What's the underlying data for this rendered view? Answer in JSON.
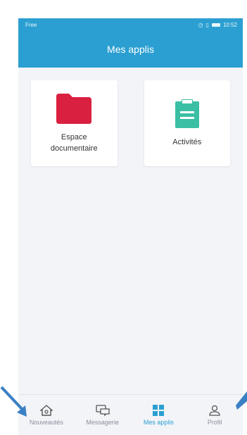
{
  "status_bar": {
    "carrier": "Free",
    "time": "10:52"
  },
  "header": {
    "title": "Mes applis"
  },
  "apps": [
    {
      "label": "Espace documentaire",
      "icon": "folder-icon",
      "color": "#d92040"
    },
    {
      "label": "Activités",
      "icon": "clipboard-icon",
      "color": "#3bbfa4"
    }
  ],
  "bottom_nav": {
    "items": [
      {
        "label": "Nouveautés",
        "icon": "home-icon",
        "active": false
      },
      {
        "label": "Messagerie",
        "icon": "chat-icon",
        "active": false
      },
      {
        "label": "Mes applis",
        "icon": "grid-icon",
        "active": true
      },
      {
        "label": "Profil",
        "icon": "user-icon",
        "active": false
      }
    ]
  },
  "colors": {
    "accent": "#2b9fd1",
    "background": "#f3f4f8",
    "arrow": "#3a80c4"
  }
}
